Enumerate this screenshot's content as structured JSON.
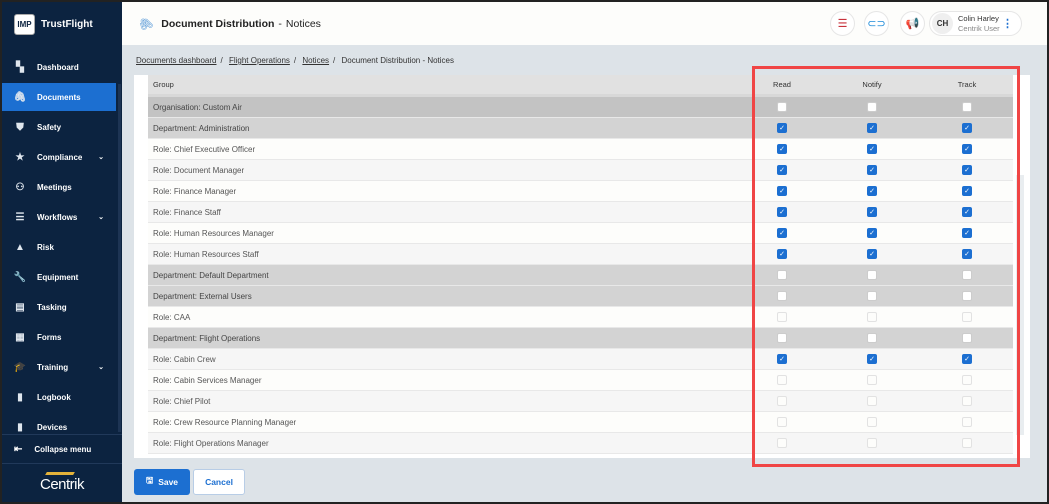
{
  "app": {
    "brand": "TrustFlight",
    "logo": "IMP",
    "footer_logo": "Centrik"
  },
  "header": {
    "title": "Document Distribution",
    "subtitle": "Notices",
    "user_initials": "CH",
    "user_name": "Colin Harley",
    "user_role": "Centrik User"
  },
  "sidebar": {
    "items": [
      {
        "label": "Dashboard",
        "icon": "dashboard-icon",
        "glyph": "▚"
      },
      {
        "label": "Documents",
        "icon": "paperclip-icon",
        "glyph": "🖇",
        "active": true
      },
      {
        "label": "Safety",
        "icon": "shield-icon",
        "glyph": "⛊"
      },
      {
        "label": "Compliance",
        "icon": "badge-icon",
        "glyph": "★",
        "chevron": true
      },
      {
        "label": "Meetings",
        "icon": "meetings-icon",
        "glyph": "⚇"
      },
      {
        "label": "Workflows",
        "icon": "workflow-icon",
        "glyph": "☰",
        "chevron": true
      },
      {
        "label": "Risk",
        "icon": "warning-icon",
        "glyph": "▲"
      },
      {
        "label": "Equipment",
        "icon": "wrench-icon",
        "glyph": "🔧"
      },
      {
        "label": "Tasking",
        "icon": "tasks-icon",
        "glyph": "▤"
      },
      {
        "label": "Forms",
        "icon": "forms-icon",
        "glyph": "▦"
      },
      {
        "label": "Training",
        "icon": "graduation-cap-icon",
        "glyph": "🎓",
        "chevron": true
      },
      {
        "label": "Logbook",
        "icon": "book-icon",
        "glyph": "▮"
      },
      {
        "label": "Devices",
        "icon": "devices-icon",
        "glyph": "▮"
      }
    ],
    "collapse": "Collapse menu"
  },
  "breadcrumb": [
    "Documents dashboard",
    "Flight Operations",
    "Notices",
    "Document Distribution - Notices"
  ],
  "table": {
    "headers": {
      "group": "Group",
      "read": "Read",
      "notify": "Notify",
      "track": "Track"
    },
    "rows": [
      {
        "group": "Organisation: Custom Air",
        "type": "org",
        "state": "off"
      },
      {
        "group": "Department: Administration",
        "type": "dept",
        "state": "on"
      },
      {
        "group": "Role: Chief Executive Officer",
        "type": "role",
        "state": "on"
      },
      {
        "group": "Role: Document Manager",
        "type": "role",
        "state": "on"
      },
      {
        "group": "Role: Finance Manager",
        "type": "role",
        "state": "on"
      },
      {
        "group": "Role: Finance Staff",
        "type": "role",
        "state": "on"
      },
      {
        "group": "Role: Human Resources Manager",
        "type": "role",
        "state": "on"
      },
      {
        "group": "Role: Human Resources Staff",
        "type": "role",
        "state": "on"
      },
      {
        "group": "Department: Default Department",
        "type": "dept",
        "state": "off"
      },
      {
        "group": "Department: External Users",
        "type": "dept",
        "state": "off"
      },
      {
        "group": "Role: CAA",
        "type": "role",
        "state": "dis"
      },
      {
        "group": "Department: Flight Operations",
        "type": "dept",
        "state": "off"
      },
      {
        "group": "Role: Cabin Crew",
        "type": "role",
        "state": "on"
      },
      {
        "group": "Role: Cabin Services Manager",
        "type": "role",
        "state": "dis"
      },
      {
        "group": "Role: Chief Pilot",
        "type": "role",
        "state": "dis"
      },
      {
        "group": "Role: Crew Resource Planning Manager",
        "type": "role",
        "state": "dis"
      },
      {
        "group": "Role: Flight Operations Manager",
        "type": "role",
        "state": "dis"
      }
    ]
  },
  "actions": {
    "save": "Save",
    "cancel": "Cancel"
  },
  "colors": {
    "accent": "#1c6fd1",
    "sidebar": "#0c2340",
    "highlight": "#f04545"
  }
}
